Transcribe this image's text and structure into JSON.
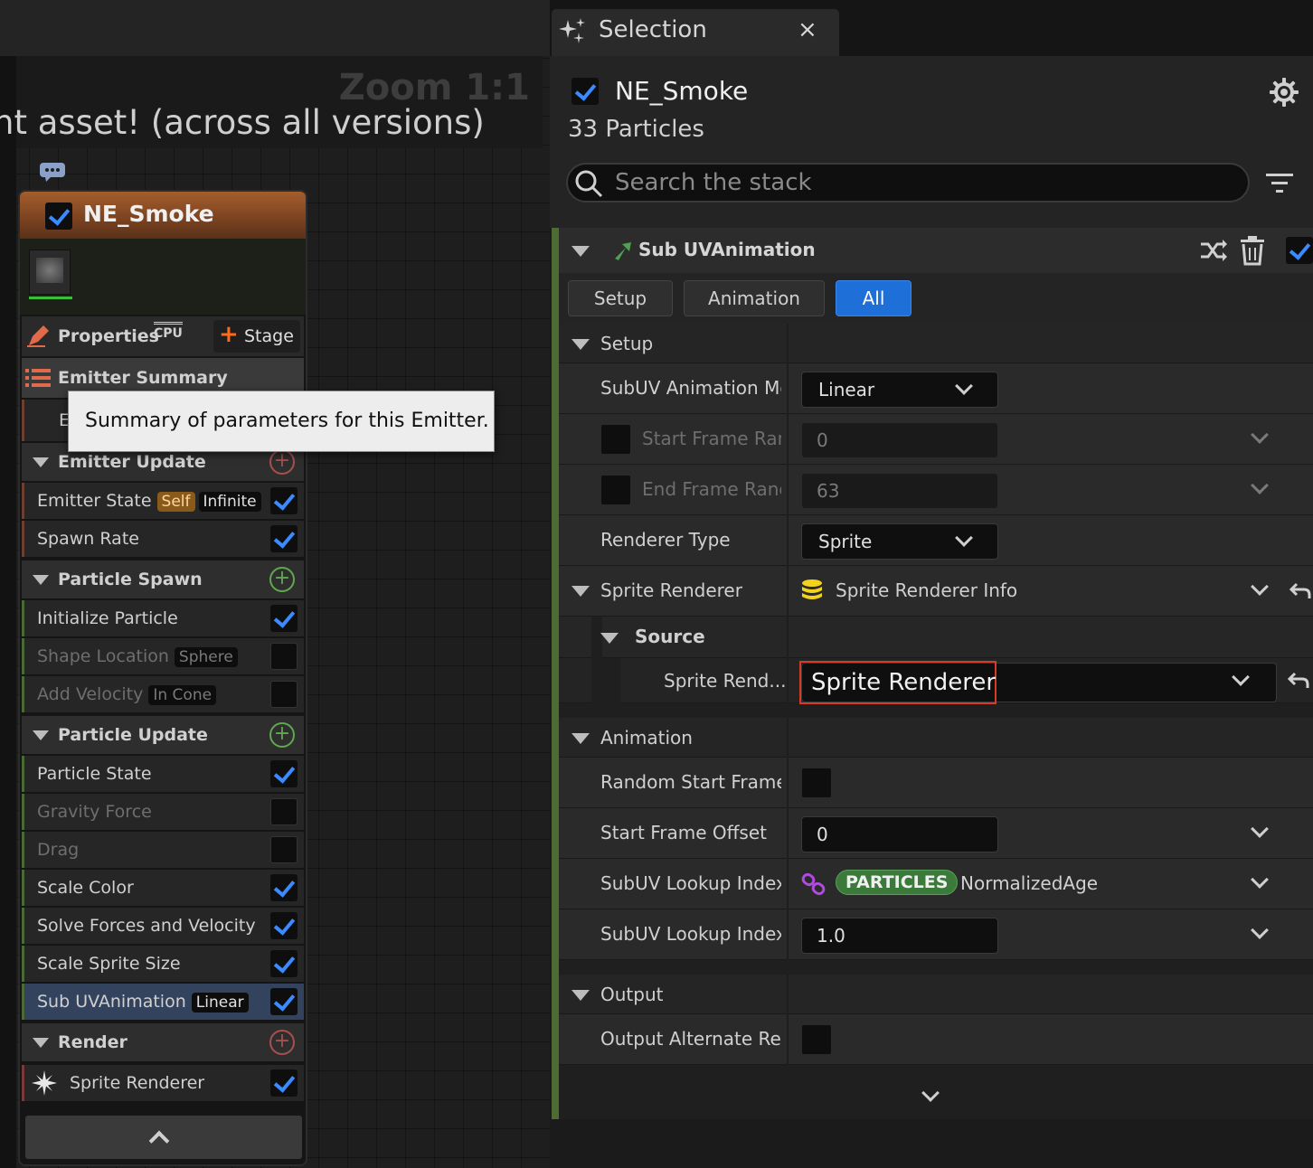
{
  "graph": {
    "zoom_label": "Zoom 1:1",
    "banner_text": "nt asset! (across all versions)"
  },
  "node": {
    "title": "NE_Smoke",
    "properties_label": "Properties",
    "cpu_label": "CPU",
    "stage_label": "Stage",
    "emitter_summary_label": "Emitter Summary",
    "tooltip_text": "Summary of parameters for this Emitter.",
    "hidden_row_initial": "E",
    "sections": {
      "emitter_update": "Emitter Update",
      "particle_spawn": "Particle Spawn",
      "particle_update": "Particle Update",
      "render": "Render"
    },
    "rows": {
      "emitter_state": "Emitter State",
      "emitter_state_tag1": "Self",
      "emitter_state_tag2": "Infinite",
      "spawn_rate": "Spawn Rate",
      "initialize_particle": "Initialize Particle",
      "shape_location": "Shape Location",
      "shape_location_tag": "Sphere",
      "add_velocity": "Add Velocity",
      "add_velocity_tag": "In Cone",
      "particle_state": "Particle State",
      "gravity_force": "Gravity Force",
      "drag": "Drag",
      "scale_color": "Scale Color",
      "solve_forces": "Solve Forces and Velocity",
      "scale_sprite_size": "Scale Sprite Size",
      "sub_uv": "Sub UVAnimation",
      "sub_uv_tag": "Linear",
      "sprite_renderer": "Sprite Renderer"
    }
  },
  "panel": {
    "tab_title": "Selection",
    "tab_close": "×",
    "emitter_name": "NE_Smoke",
    "particle_count": "33 Particles",
    "search_placeholder": "Search the stack",
    "module_title": "Sub UVAnimation",
    "tabs": [
      "Setup",
      "Animation",
      "All"
    ],
    "setup": {
      "category": "Setup",
      "subuv_mode_label": "SubUV Animation Mc",
      "subuv_mode_value": "Linear",
      "start_frame_label": "Start Frame Ran",
      "start_frame_value": "0",
      "end_frame_label": "End Frame Ranc",
      "end_frame_value": "63",
      "renderer_type_label": "Renderer Type",
      "renderer_type_value": "Sprite",
      "sprite_renderer_label": "Sprite Renderer",
      "sprite_renderer_value": "Sprite Renderer Info",
      "source_label": "Source",
      "sprite_rend_label": "Sprite Rend...",
      "sprite_rend_value": "Sprite Renderer"
    },
    "animation": {
      "category": "Animation",
      "random_start_label": "Random Start Frame",
      "start_offset_label": "Start Frame Offset",
      "start_offset_value": "0",
      "lookup1_label": "SubUV Lookup Index",
      "lookup1_pill": "PARTICLES",
      "lookup1_value": "NormalizedAge",
      "lookup2_label": "SubUV Lookup Index",
      "lookup2_value": "1.0"
    },
    "output": {
      "category": "Output",
      "alt_label": "Output Alternate Ren"
    }
  },
  "colors": {
    "accent_blue": "#1f6fd9",
    "highlight_red": "#d83a2a",
    "module_green": "#4d6b33",
    "node_header_orange": "#a45d2c"
  }
}
